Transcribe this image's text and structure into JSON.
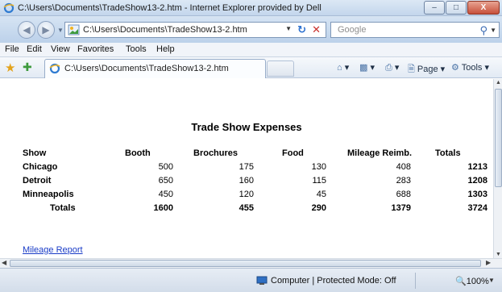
{
  "window": {
    "title": "C:\\Users\\Documents\\TradeShow13-2.htm - Internet Explorer provided by Dell",
    "min_label": "–",
    "max_label": "□",
    "close_label": "X"
  },
  "address": {
    "url": "C:\\Users\\Documents\\TradeShow13-2.htm",
    "search_placeholder": "Google"
  },
  "menu": {
    "items": [
      "File",
      "Edit",
      "View",
      "Favorites",
      "Tools",
      "Help"
    ]
  },
  "tab": {
    "label": "C:\\Users\\Documents\\TradeShow13-2.htm"
  },
  "commands": {
    "page": "Page",
    "tools": "Tools"
  },
  "report": {
    "title": "Trade Show Expenses",
    "headers": [
      "Show",
      "Booth",
      "Brochures",
      "Food",
      "Mileage Reimb.",
      "Totals"
    ],
    "rows": [
      [
        "Chicago",
        "500",
        "175",
        "130",
        "408",
        "1213"
      ],
      [
        "Detroit",
        "650",
        "160",
        "115",
        "283",
        "1208"
      ],
      [
        "Minneapolis",
        "450",
        "120",
        "45",
        "688",
        "1303"
      ]
    ],
    "totals": [
      "Totals",
      "1600",
      "455",
      "290",
      "1379",
      "3724"
    ],
    "link": "Mileage Report"
  },
  "status": {
    "zone": "Computer | Protected Mode: Off",
    "zoom": "100%"
  }
}
